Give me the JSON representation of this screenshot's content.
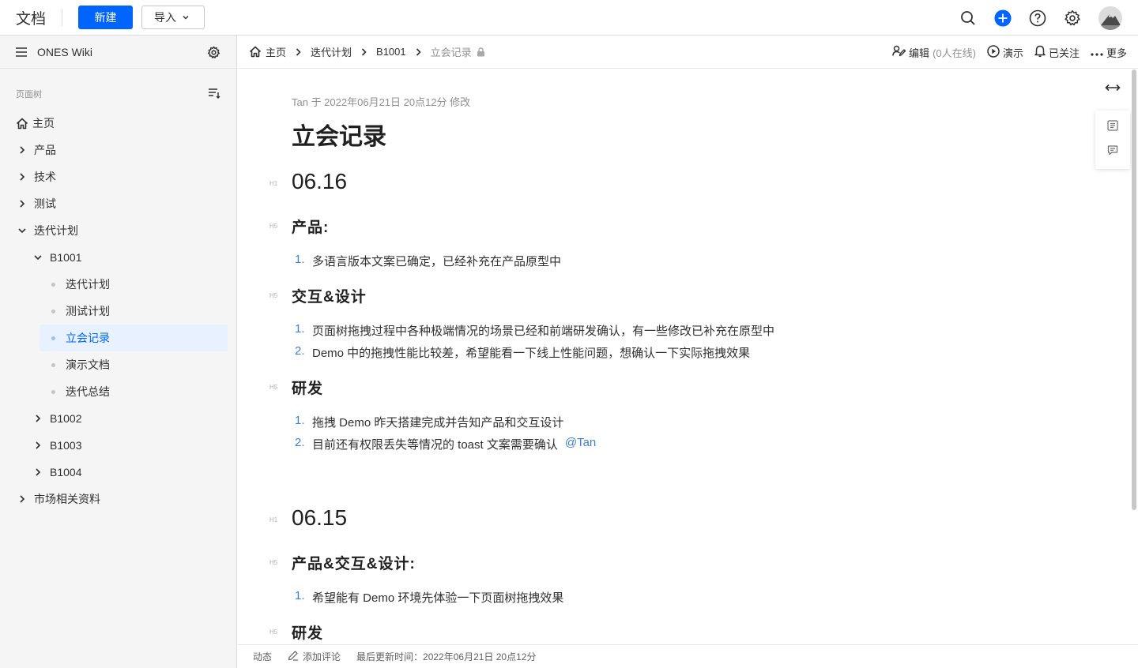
{
  "header": {
    "app_title": "文档",
    "new_label": "新建",
    "import_label": "导入",
    "accent": "#0064ff"
  },
  "sidebar": {
    "title": "ONES Wiki",
    "tree_label": "页面树",
    "nodes": [
      {
        "label": "主页",
        "icon": "home-icon"
      },
      {
        "label": "产品",
        "icon": "chevron-right-icon"
      },
      {
        "label": "技术",
        "icon": "chevron-right-icon"
      },
      {
        "label": "测试",
        "icon": "chevron-right-icon"
      },
      {
        "label": "迭代计划",
        "icon": "chevron-down-icon"
      },
      {
        "label": "B1001",
        "icon": "chevron-down-icon"
      },
      {
        "label": "迭代计划",
        "icon": "dot-icon"
      },
      {
        "label": "测试计划",
        "icon": "dot-icon"
      },
      {
        "label": "立会记录",
        "icon": "dot-icon",
        "active": true
      },
      {
        "label": "演示文档",
        "icon": "dot-icon"
      },
      {
        "label": "迭代总结",
        "icon": "dot-icon"
      },
      {
        "label": "B1002",
        "icon": "chevron-right-icon"
      },
      {
        "label": "B1003",
        "icon": "chevron-right-icon"
      },
      {
        "label": "B1004",
        "icon": "chevron-right-icon"
      },
      {
        "label": "市场相关资料",
        "icon": "chevron-right-icon"
      }
    ]
  },
  "breadcrumb": {
    "items": [
      "主页",
      "迭代计划",
      "B1001",
      "立会记录"
    ]
  },
  "actions": {
    "edit": "编辑",
    "online": "(0人在线)",
    "present": "演示",
    "follow": "已关注",
    "more": "更多"
  },
  "doc": {
    "meta": "Tan 于 2022年06月21日 20点12分 修改",
    "title": "立会记录",
    "tag_h1": "H1",
    "tag_h5": "H5",
    "sections": [
      {
        "h1": "06.16"
      },
      {
        "h5": "产品:",
        "items": [
          "多语言版本文案已确定，已经补充在产品原型中"
        ]
      },
      {
        "h5": "交互&设计",
        "items": [
          "页面树拖拽过程中各种极端情况的场景已经和前端研发确认，有一些修改已补充在原型中",
          "Demo 中的拖拽性能比较差，希望能看一下线上性能问题，想确认一下实际拖拽效果"
        ]
      },
      {
        "h5": "研发",
        "items": [
          "拖拽 Demo 昨天搭建完成并告知产品和交互设计",
          "目前还有权限丢失等情况的 toast 文案需要确认"
        ],
        "mention": "@Tan"
      },
      {
        "h1": "06.15"
      },
      {
        "h5": "产品&交互&设计:",
        "items": [
          "希望能有 Demo 环境先体验一下页面树拖拽效果"
        ]
      },
      {
        "h5": "研发"
      }
    ]
  },
  "footer": {
    "activity": "动态",
    "add_comment": "添加评论",
    "last_updated": "最后更新时间：2022年06月21日 20点12分"
  }
}
